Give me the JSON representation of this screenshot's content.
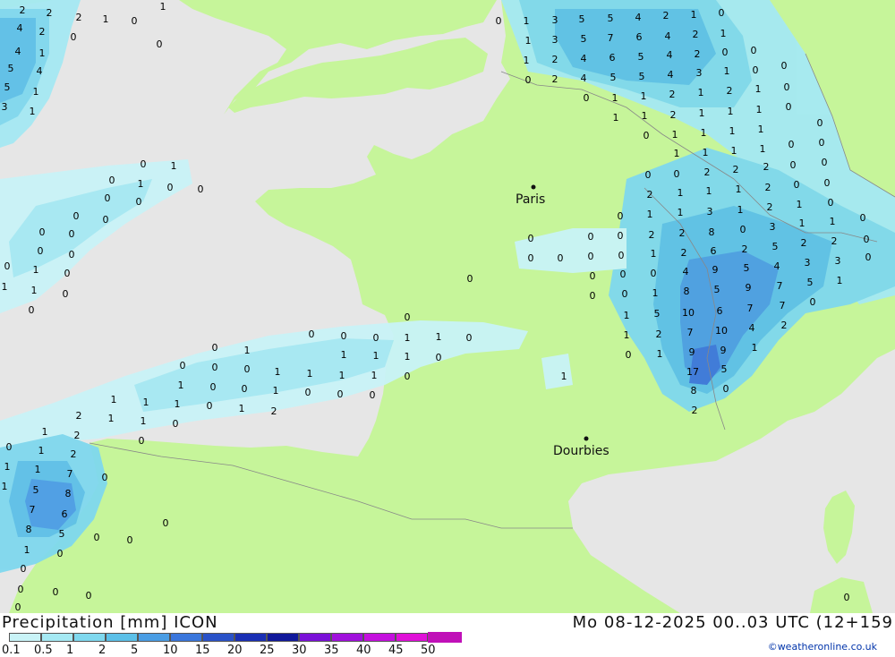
{
  "map": {
    "colors": {
      "sea": "#e6e6e6",
      "land": "#c6f59a",
      "border": "#888888",
      "p01": "#c9f3f7",
      "p05": "#a5e9f3",
      "p1": "#7fd8ee",
      "p2": "#5cc0e8",
      "p5": "#4a9de4",
      "p10": "#3a76dc",
      "p15": "#2a52c8"
    },
    "cities": [
      {
        "name": "Paris"
      },
      {
        "name": "Dourbies"
      }
    ]
  },
  "footer": {
    "title": "Precipitation [mm] ICON",
    "valid": "Mo 08-12-2025 00..03 UTC (12+159",
    "credit": "©weatheronline.co.uk"
  },
  "legend": {
    "labels": [
      "0.1",
      "0.5",
      "1",
      "2",
      "5",
      "10",
      "15",
      "20",
      "25",
      "30",
      "35",
      "40",
      "45",
      "50"
    ],
    "colors": [
      "#c9f3f7",
      "#a5e9f3",
      "#7fd8ee",
      "#5cc0e8",
      "#4a9de4",
      "#3a76dc",
      "#2a52c8",
      "#1a2fb4",
      "#10189a",
      "#7a10d8",
      "#a010dc",
      "#c410de",
      "#e010d8",
      "#c010b8"
    ]
  }
}
